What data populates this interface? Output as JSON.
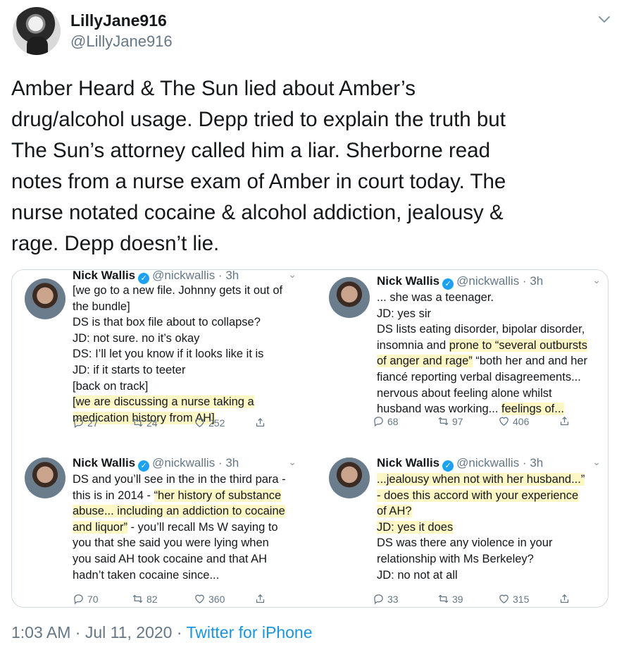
{
  "author": {
    "display_name": "LillyJane916",
    "handle": "@LillyJane916"
  },
  "tweet": {
    "text": "Amber Heard & The Sun lied about Amber’s\ndrug/alcohol usage. Depp tried to explain the truth but\nThe Sun’s attorney called him a liar. Sherborne read\nnotes from a nurse exam of Amber in court today. The\nnurse notated cocaine & alcohol addiction, jealousy &\nrage. Depp doesn’t lie.",
    "time": "1:03 AM",
    "separator": "·",
    "date": "Jul 11, 2020",
    "source": "Twitter for iPhone"
  },
  "embedded": [
    {
      "name": "Nick Wallis",
      "handle": "@nickwallis",
      "age": "3h",
      "lines": [
        "[we go to a new file. Johnny gets it out of",
        "the bundle]",
        "DS is that box file about to collapse?",
        "JD: not sure. no it’s okay",
        "DS: I’ll let you know if it looks like it is",
        "JD: if it starts to teeter",
        "[back on track]",
        "[we are discussing a nurse taking a",
        "medication history from AH]"
      ],
      "replies": "27",
      "retweets": "24",
      "likes": "252"
    },
    {
      "name": "Nick Wallis",
      "handle": "@nickwallis",
      "age": "3h",
      "lines": [
        "... she was a teenager.",
        "JD: yes sir",
        "DS lists eating disorder, bipolar disorder,",
        "insomnia and ",
        "prone to “several outbursts",
        "of anger and rage”",
        " “both her and and her",
        "fiancé reporting verbal disagreements...",
        "nervous about feeling alone whilst",
        "husband was working... ",
        "feelings of..."
      ],
      "replies": "68",
      "retweets": "97",
      "likes": "406"
    },
    {
      "name": "Nick Wallis",
      "handle": "@nickwallis",
      "age": "3h",
      "lines": [
        "DS and you’ll see in the in the third para -",
        "this is in 2014 - ",
        "“her history of substance",
        "abuse... including an addiction to cocaine",
        "and liquor”",
        " - you’ll recall Ms W saying to",
        "you that she said you were lying when",
        "you said AH took cocaine and that AH",
        "hadn’t taken cocaine since..."
      ],
      "replies": "70",
      "retweets": "82",
      "likes": "360"
    },
    {
      "name": "Nick Wallis",
      "handle": "@nickwallis",
      "age": "3h",
      "lines": [
        "...jealousy when not with her husband...”",
        "- does this accord with your experience",
        "of AH?",
        "JD: yes it does",
        "DS was there any violence in your",
        "relationship with Ms Berkeley?",
        "JD: no not at all"
      ],
      "replies": "33",
      "retweets": "39",
      "likes": "315"
    }
  ],
  "colors": {
    "text": "#14171a",
    "muted": "#657786",
    "link": "#1b95e0",
    "verified": "#1da1f2",
    "highlight": "#fdf7c6"
  }
}
